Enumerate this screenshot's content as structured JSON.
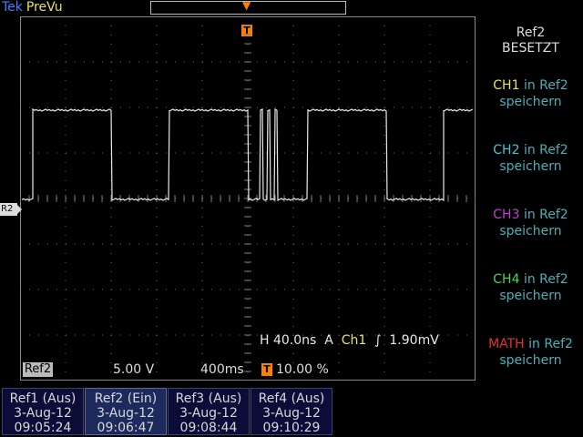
{
  "header": {
    "brand": "Tek",
    "mode": "PreVu",
    "trigger_marker": "T"
  },
  "reference_marker": "R2",
  "horizontal": {
    "prefix": "H",
    "timebase": "40.0ns",
    "mode": "A",
    "channel": "Ch1",
    "trigger_level": "1.90mV"
  },
  "status": {
    "ref": "Ref2",
    "volts_div": "5.00 V",
    "time_div": "400ms",
    "trigger_position": "10.00 %"
  },
  "menu": {
    "title": "Ref2",
    "subtitle": "BESETZT",
    "items": [
      {
        "src": "CH1",
        "rest": "in Ref2",
        "line2": "speichern",
        "color": "#e8e064"
      },
      {
        "src": "CH2",
        "rest": "in Ref2",
        "line2": "speichern",
        "color": "#40c8d8"
      },
      {
        "src": "CH3",
        "rest": "in Ref2",
        "line2": "speichern",
        "color": "#c040c8"
      },
      {
        "src": "CH4",
        "rest": "in Ref2",
        "line2": "speichern",
        "color": "#40d860"
      },
      {
        "src": "MATH",
        "rest": "in Ref2",
        "line2": "speichern",
        "color": "#e83030"
      }
    ]
  },
  "tabs": [
    {
      "label": "Ref1 (Aus)",
      "date": "3-Aug-12",
      "time": "09:05:24"
    },
    {
      "label": "Ref2 (Ein)",
      "date": "3-Aug-12",
      "time": "09:06:47"
    },
    {
      "label": "Ref3 (Aus)",
      "date": "3-Aug-12",
      "time": "09:08:44"
    },
    {
      "label": "Ref4 (Aus)",
      "date": "3-Aug-12",
      "time": "09:10:29"
    }
  ],
  "colors": {
    "trace": "#e8e8e8",
    "trigger": "#ff8000",
    "grid": "#6a6a6a",
    "accent": "#3c82ff"
  }
}
